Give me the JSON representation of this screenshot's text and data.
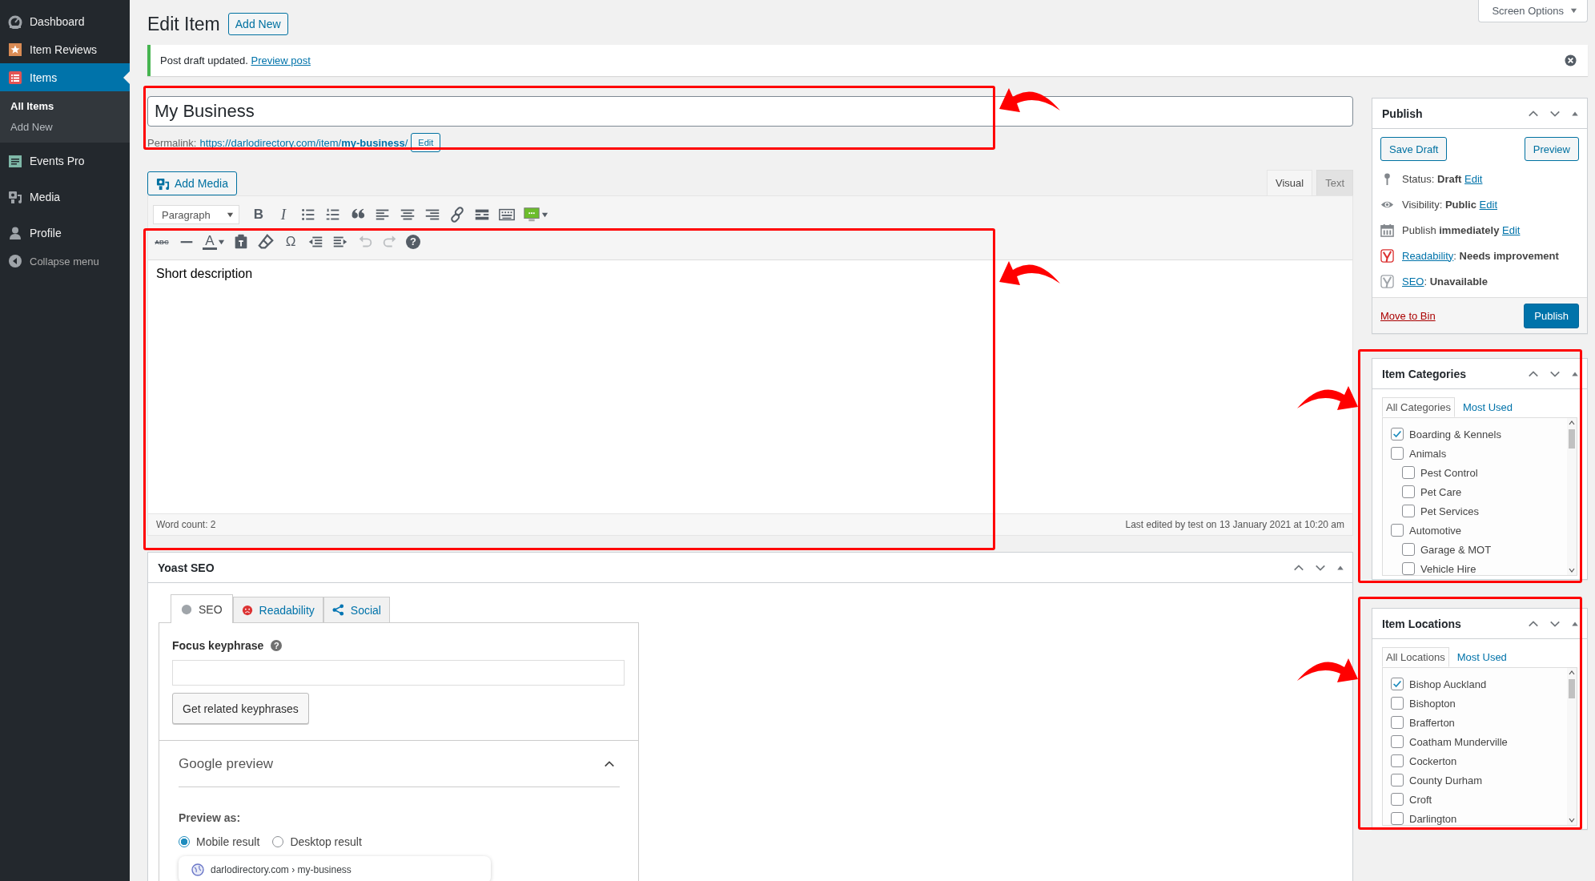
{
  "sidebar": {
    "items": [
      {
        "kind": "dashboard",
        "label": "Dashboard",
        "selected": false
      },
      {
        "kind": "reviews",
        "label": "Item Reviews",
        "selected": false
      },
      {
        "kind": "items",
        "label": "Items",
        "selected": true,
        "children": [
          {
            "label": "All Items",
            "selected": true
          },
          {
            "label": "Add New",
            "selected": false
          }
        ]
      },
      {
        "kind": "events",
        "label": "Events Pro",
        "selected": false
      },
      {
        "kind": "media",
        "label": "Media",
        "selected": false
      },
      {
        "kind": "profile",
        "label": "Profile",
        "selected": false
      }
    ],
    "collapse": "Collapse menu"
  },
  "screen_options": "Screen Options",
  "page_title": "Edit Item",
  "add_new": "Add New",
  "notice": {
    "text": "Post draft updated.",
    "link": "Preview post"
  },
  "title_field": {
    "value": "My Business"
  },
  "permalink": {
    "label": "Permalink:",
    "url": "https://darlodirectory.com/item/**my-business**/",
    "edit": "Edit"
  },
  "add_media": "Add Media",
  "editor_tabs": [
    {
      "label": "Visual",
      "selected": true
    },
    {
      "label": "Text",
      "selected": false
    }
  ],
  "format_select": "Paragraph",
  "toolbar_rows": [
    [
      {
        "kind": "bold",
        "glyph": "B",
        "disabled": false
      },
      {
        "kind": "italic",
        "glyph": "I",
        "disabled": false
      },
      {
        "kind": "bullet-list",
        "disabled": false
      },
      {
        "kind": "numbered-list",
        "disabled": false
      },
      {
        "kind": "blockquote",
        "disabled": false
      },
      {
        "kind": "align-left",
        "disabled": false
      },
      {
        "kind": "align-center",
        "disabled": false
      },
      {
        "kind": "align-right",
        "disabled": false
      },
      {
        "kind": "link",
        "disabled": false
      },
      {
        "kind": "read-more",
        "disabled": false
      },
      {
        "kind": "toolbar-toggle",
        "disabled": false
      },
      {
        "kind": "monitor",
        "disabled": false
      }
    ],
    [
      {
        "kind": "strikethrough",
        "glyph": "ABC",
        "disabled": false
      },
      {
        "kind": "horizontal-line",
        "disabled": false
      },
      {
        "kind": "text-color",
        "glyph": "A",
        "disabled": false
      },
      {
        "kind": "paste-text",
        "disabled": false
      },
      {
        "kind": "clear-formatting",
        "disabled": false
      },
      {
        "kind": "special-character",
        "glyph": "Ω",
        "disabled": false
      },
      {
        "kind": "outdent",
        "disabled": false
      },
      {
        "kind": "indent",
        "disabled": false
      },
      {
        "kind": "undo",
        "disabled": true
      },
      {
        "kind": "redo",
        "disabled": true
      },
      {
        "kind": "help",
        "glyph": "?",
        "disabled": false
      }
    ]
  ],
  "editor": {
    "content": "Short description",
    "word_count": "Word count: 2",
    "last_edited": "Last edited by test on 13 January 2021 at 10:20 am"
  },
  "yoast": {
    "title": "Yoast SEO",
    "tabs": [
      {
        "kind": "seo",
        "label": "SEO",
        "selected": true
      },
      {
        "kind": "readability",
        "label": "Readability",
        "selected": false
      },
      {
        "kind": "social",
        "label": "Social",
        "selected": false
      }
    ],
    "focus_label": "Focus keyphrase",
    "focus_help": "?",
    "related_button": "Get related keyphrases",
    "google_preview": {
      "title": "Google preview",
      "expanded": true
    },
    "preview_as": "Preview as:",
    "modes": [
      {
        "label": "Mobile result",
        "selected": true
      },
      {
        "label": "Desktop result",
        "selected": false
      }
    ],
    "breadcrumb": "darlodirectory.com › my-business"
  },
  "publish": {
    "title": "Publish",
    "save_draft": "Save Draft",
    "preview": "Preview",
    "rows": [
      {
        "kind": "status",
        "text": "Status: **Draft**",
        "link": "Edit"
      },
      {
        "kind": "visibility",
        "text": "Visibility: **Public**",
        "link": "Edit"
      },
      {
        "kind": "schedule",
        "text": "Publish **immediately**",
        "link": "Edit"
      },
      {
        "kind": "readability",
        "link": "Readability",
        "text": ": **Needs improvement**"
      },
      {
        "kind": "seo",
        "link": "SEO",
        "text": ": **Unavailable**"
      }
    ],
    "trash": "Move to Bin",
    "publish_button": "Publish"
  },
  "categories": {
    "title": "Item Categories",
    "tabs": [
      {
        "label": "All Categories",
        "selected": true
      },
      {
        "label": "Most Used",
        "selected": false
      }
    ],
    "items": [
      {
        "label": "Boarding & Kennels",
        "checked": true
      },
      {
        "label": "Animals",
        "checked": false,
        "children": [
          {
            "label": "Pest Control",
            "checked": false
          },
          {
            "label": "Pet Care",
            "checked": false
          },
          {
            "label": "Pet Services",
            "checked": false
          }
        ]
      },
      {
        "label": "Automotive",
        "checked": false,
        "children": [
          {
            "label": "Garage & MOT",
            "checked": false
          },
          {
            "label": "Vehicle Hire",
            "checked": false
          }
        ]
      }
    ]
  },
  "locations": {
    "title": "Item Locations",
    "tabs": [
      {
        "label": "All Locations",
        "selected": true
      },
      {
        "label": "Most Used",
        "selected": false
      }
    ],
    "items": [
      {
        "label": "Bishop Auckland",
        "checked": true
      },
      {
        "label": "Bishopton",
        "checked": false
      },
      {
        "label": "Brafferton",
        "checked": false
      },
      {
        "label": "Coatham Munderville",
        "checked": false
      },
      {
        "label": "Cockerton",
        "checked": false
      },
      {
        "label": "County Durham",
        "checked": false
      },
      {
        "label": "Croft",
        "checked": false
      },
      {
        "label": "Darlington",
        "checked": false
      }
    ]
  }
}
